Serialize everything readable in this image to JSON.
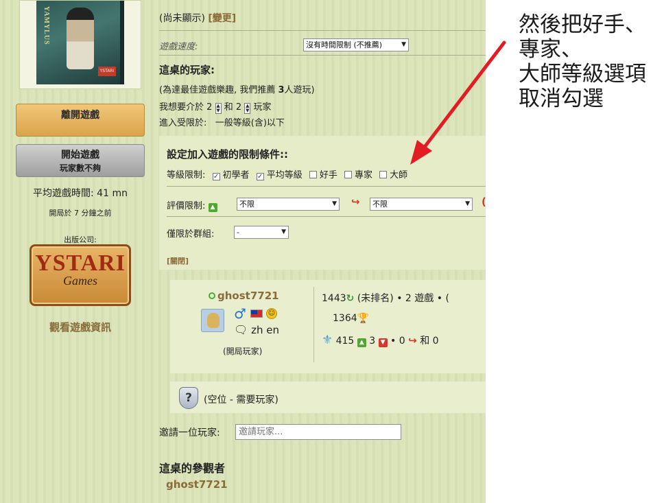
{
  "left": {
    "box_title": "YAMYLUS",
    "leave_button": "離開遊戲",
    "start_button": "開始遊戲",
    "start_sub": "玩家數不夠",
    "avg_time": "平均遊戲時間: 41 mn",
    "started_ago": "開局於 7 分鐘之前",
    "publisher_label": "出版公司:",
    "publisher_brand": "YSTARI",
    "publisher_sub": "Games",
    "view_info": "觀看遊戲資訊"
  },
  "main": {
    "not_shown": "(尚未顯示)",
    "change_link": "[變更]",
    "speed_label": "遊戲速度:",
    "speed_value": "沒有時間限制 (不推薦)",
    "players_title": "這桌的玩家:",
    "players_rec_prefix": "(為達最佳遊戲樂趣, 我們推薦",
    "players_rec_count": "3",
    "players_rec_suffix": "人遊玩)",
    "players_between_1": "我想要介於",
    "players_min": "2",
    "players_between_2": "和",
    "players_max": "2",
    "players_between_3": "玩家",
    "players_restrict": "進入受限於:   一般等級(含)以下"
  },
  "restrictions": {
    "title": "設定加入遊戲的限制條件::",
    "level_label": "等級限制:",
    "levels": [
      {
        "label": "初學者",
        "checked": true
      },
      {
        "label": "平均等級",
        "checked": true
      },
      {
        "label": "好手",
        "checked": false
      },
      {
        "label": "專家",
        "checked": false
      },
      {
        "label": "大師",
        "checked": false
      }
    ],
    "rating_label": "評價限制:",
    "rating_value_1": "不限",
    "rating_value_2": "不限",
    "group_label": "僅限於群組:",
    "group_value": "-",
    "close_link": "[關閉]"
  },
  "player": {
    "name": "ghost7721",
    "gender_symbol": "♂",
    "languages": "zh en",
    "host_label": "(開局玩家)",
    "elo": "1443",
    "rank": "(未排名)",
    "games_text": "• 2 遊戲 • (",
    "trophy_score": "1364",
    "thumbs_up": "415",
    "thumbs_down": "3",
    "leaves": "0",
    "and_text": "和 0"
  },
  "empty_seat": {
    "icon_glyph": "?",
    "text": "(空位 - 需要玩家)"
  },
  "invite": {
    "label": "邀請一位玩家:",
    "placeholder": "邀請玩家..."
  },
  "spectators": {
    "title": "這桌的參觀者",
    "name": "ghost7721"
  },
  "annotation": {
    "line1": "然後把好手、",
    "line2": "專家、",
    "line3": "大師等級選項",
    "line4": "取消勾選",
    "arrow_color": "#e31b23"
  }
}
